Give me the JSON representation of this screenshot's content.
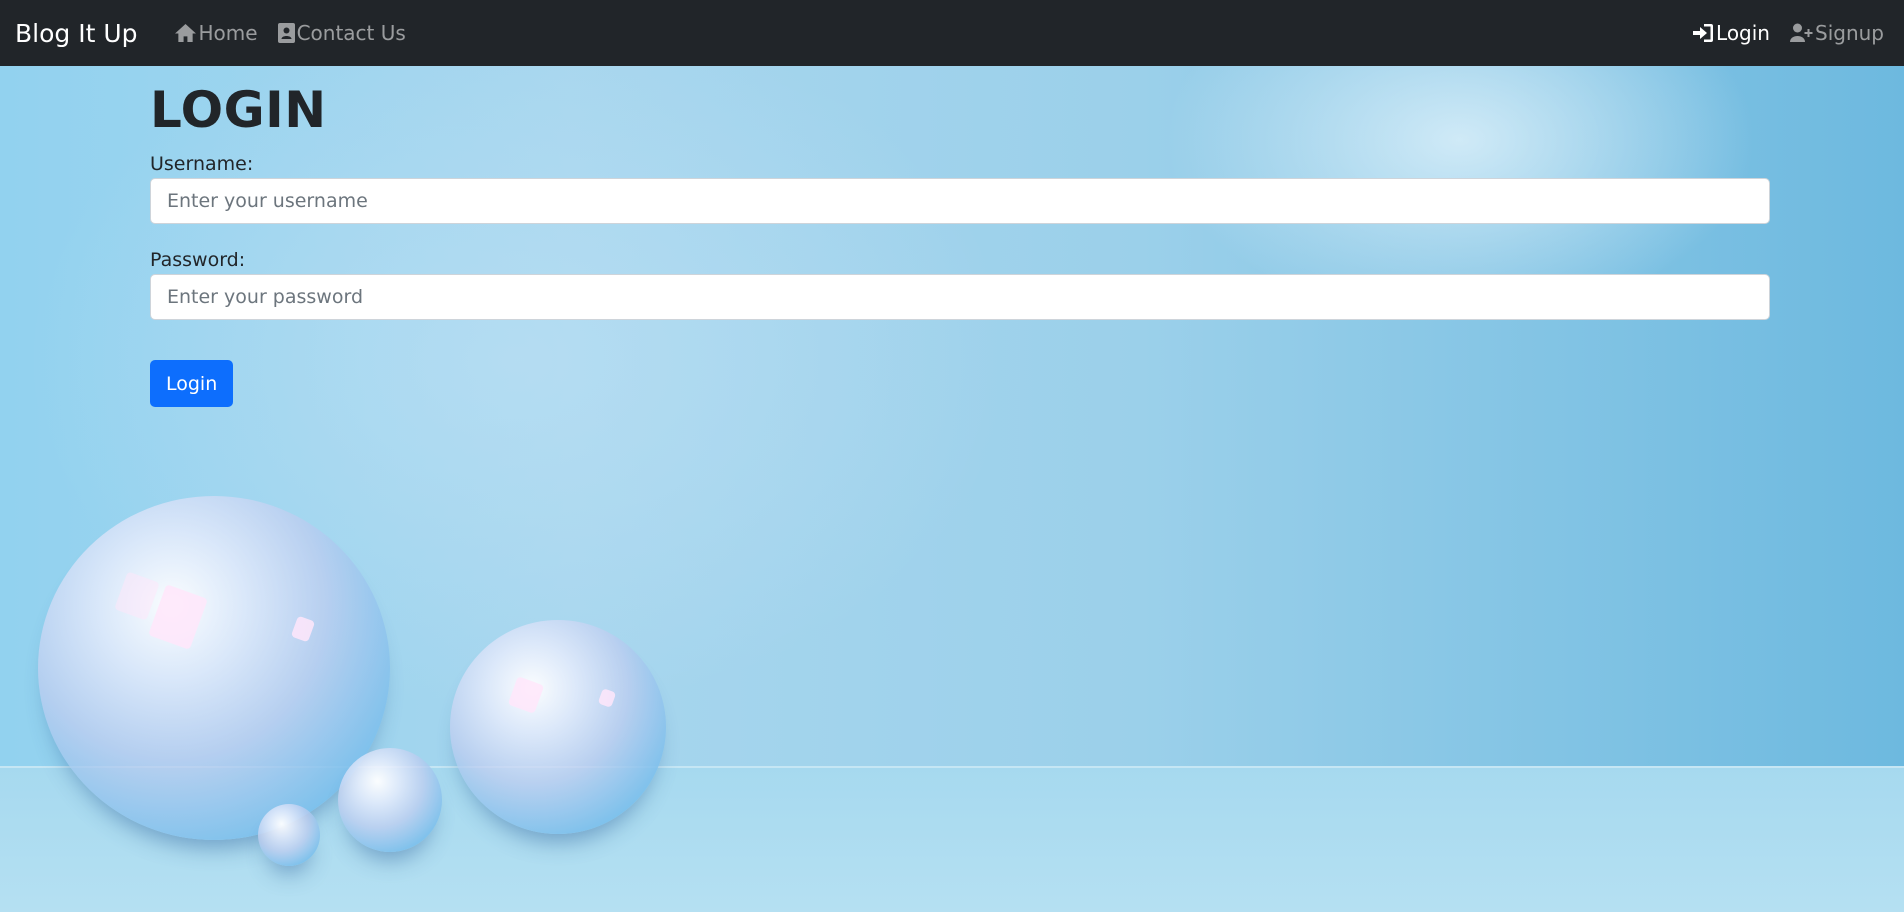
{
  "navbar": {
    "brand": "Blog It Up",
    "left_links": [
      {
        "label": "Home",
        "icon": "home-icon"
      },
      {
        "label": "Contact Us",
        "icon": "contact-card-icon"
      }
    ],
    "right_links": [
      {
        "label": "Login",
        "icon": "sign-in-icon",
        "active": true
      },
      {
        "label": "Signup",
        "icon": "user-plus-icon",
        "active": false
      }
    ],
    "background": "#212529"
  },
  "form": {
    "title": "LOGIN",
    "username_label": "Username:",
    "username_placeholder": "Enter your username",
    "username_value": "",
    "password_label": "Password:",
    "password_placeholder": "Enter your password",
    "password_value": "",
    "submit_label": "Login",
    "submit_color": "#0d6efd"
  }
}
